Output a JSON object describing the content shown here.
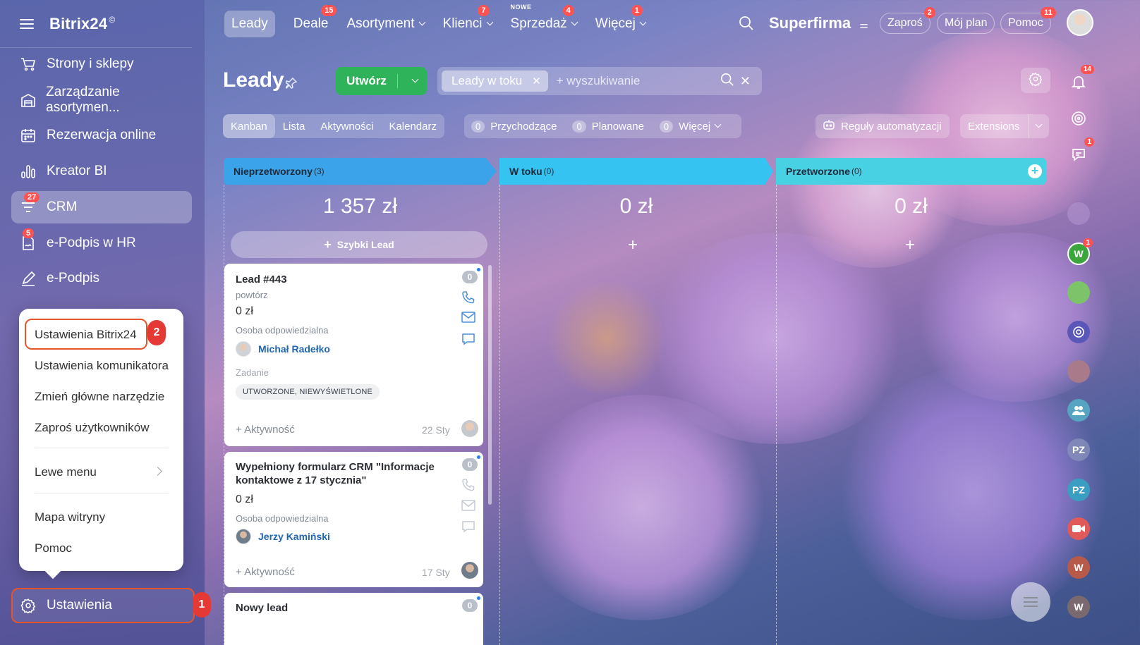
{
  "sidebar": {
    "logo": "Bitrix24",
    "logo_mark": "©",
    "items": [
      {
        "label": "Strony i sklepy",
        "icon": "cart-icon",
        "badge": ""
      },
      {
        "label": "Zarządzanie asortymen...",
        "icon": "warehouse-icon",
        "badge": ""
      },
      {
        "label": "Rezerwacja online",
        "icon": "calendar-icon",
        "badge": ""
      },
      {
        "label": "Kreator BI",
        "icon": "bar-chart-icon",
        "badge": ""
      },
      {
        "label": "CRM",
        "icon": "funnel-icon",
        "badge": "27"
      },
      {
        "label": "e-Podpis w HR",
        "icon": "signature-doc-icon",
        "badge": "5"
      },
      {
        "label": "e-Podpis",
        "icon": "pen-icon",
        "badge": ""
      }
    ],
    "settings_label": "Ustawienia",
    "settings_step": "1"
  },
  "popup": {
    "items": [
      "Ustawienia Bitrix24",
      "Ustawienia komunikatora",
      "Zmień główne narzędzie",
      "Zaproś użytkowników",
      "Lewe menu",
      "Mapa witryny",
      "Pomoc"
    ],
    "step": "2"
  },
  "topnav": {
    "items": [
      {
        "label": "Leady",
        "badge": "",
        "new": ""
      },
      {
        "label": "Deale",
        "badge": "15",
        "new": ""
      },
      {
        "label": "Asortyment",
        "badge": "",
        "new": ""
      },
      {
        "label": "Klienci",
        "badge": "7",
        "new": ""
      },
      {
        "label": "Sprzedaż",
        "badge": "4",
        "new": "NOWE"
      },
      {
        "label": "Więcej",
        "badge": "1",
        "new": ""
      }
    ],
    "company": "Superfirma",
    "invite": {
      "label": "Zaproś",
      "badge": "2"
    },
    "plan": "Mój plan",
    "help": {
      "label": "Pomoc",
      "badge": "11"
    }
  },
  "page": {
    "title": "Leady",
    "create_label": "Utwórz",
    "filter_chip": "Leady w toku",
    "search_placeholder": "+ wyszukiwanie",
    "views": [
      "Kanban",
      "Lista",
      "Aktywności",
      "Kalendarz"
    ],
    "counters": [
      {
        "count": "0",
        "label": "Przychodzące"
      },
      {
        "count": "0",
        "label": "Planowane"
      },
      {
        "count": "0",
        "label": "Więcej"
      }
    ],
    "automation": "Reguły automatyzacji",
    "extensions": "Extensions"
  },
  "kanban": {
    "columns": [
      {
        "title": "Nieprzetworzony",
        "count": "(3)",
        "sum": "1 357 zł",
        "color": "#3ba3ea"
      },
      {
        "title": "W toku",
        "count": "(0)",
        "sum": "0 zł",
        "color": "#35c4f2"
      },
      {
        "title": "Przetworzone",
        "count": "(0)",
        "sum": "0 zł",
        "color": "#47d1e2"
      }
    ],
    "quick_lead": "Szybki Lead",
    "cards": [
      {
        "title": "Lead #443",
        "sub": "powtórz",
        "amount": "0 zł",
        "resp_label": "Osoba odpowiedzialna",
        "person": "Michał Radełko",
        "task_label": "Zadanie",
        "tag": "UTWORZONE, NIEWYŚWIETLONE",
        "activity": "+ Aktywność",
        "date": "22 Sty",
        "count": "0"
      },
      {
        "title": "Wypełniony formularz CRM \"Informacje kontaktowe z 17 stycznia\"",
        "amount": "0 zł",
        "resp_label": "Osoba odpowiedzialna",
        "person": "Jerzy Kamiński",
        "activity": "+ Aktywność",
        "date": "17 Sty",
        "count": "0"
      },
      {
        "title": "Nowy lead",
        "count": "0"
      }
    ]
  },
  "rail": {
    "notif_badge": "14",
    "chat_badge": "1",
    "w_badge": "1",
    "avatars": [
      "W",
      "PZ",
      "PZ",
      "W",
      "W"
    ]
  }
}
